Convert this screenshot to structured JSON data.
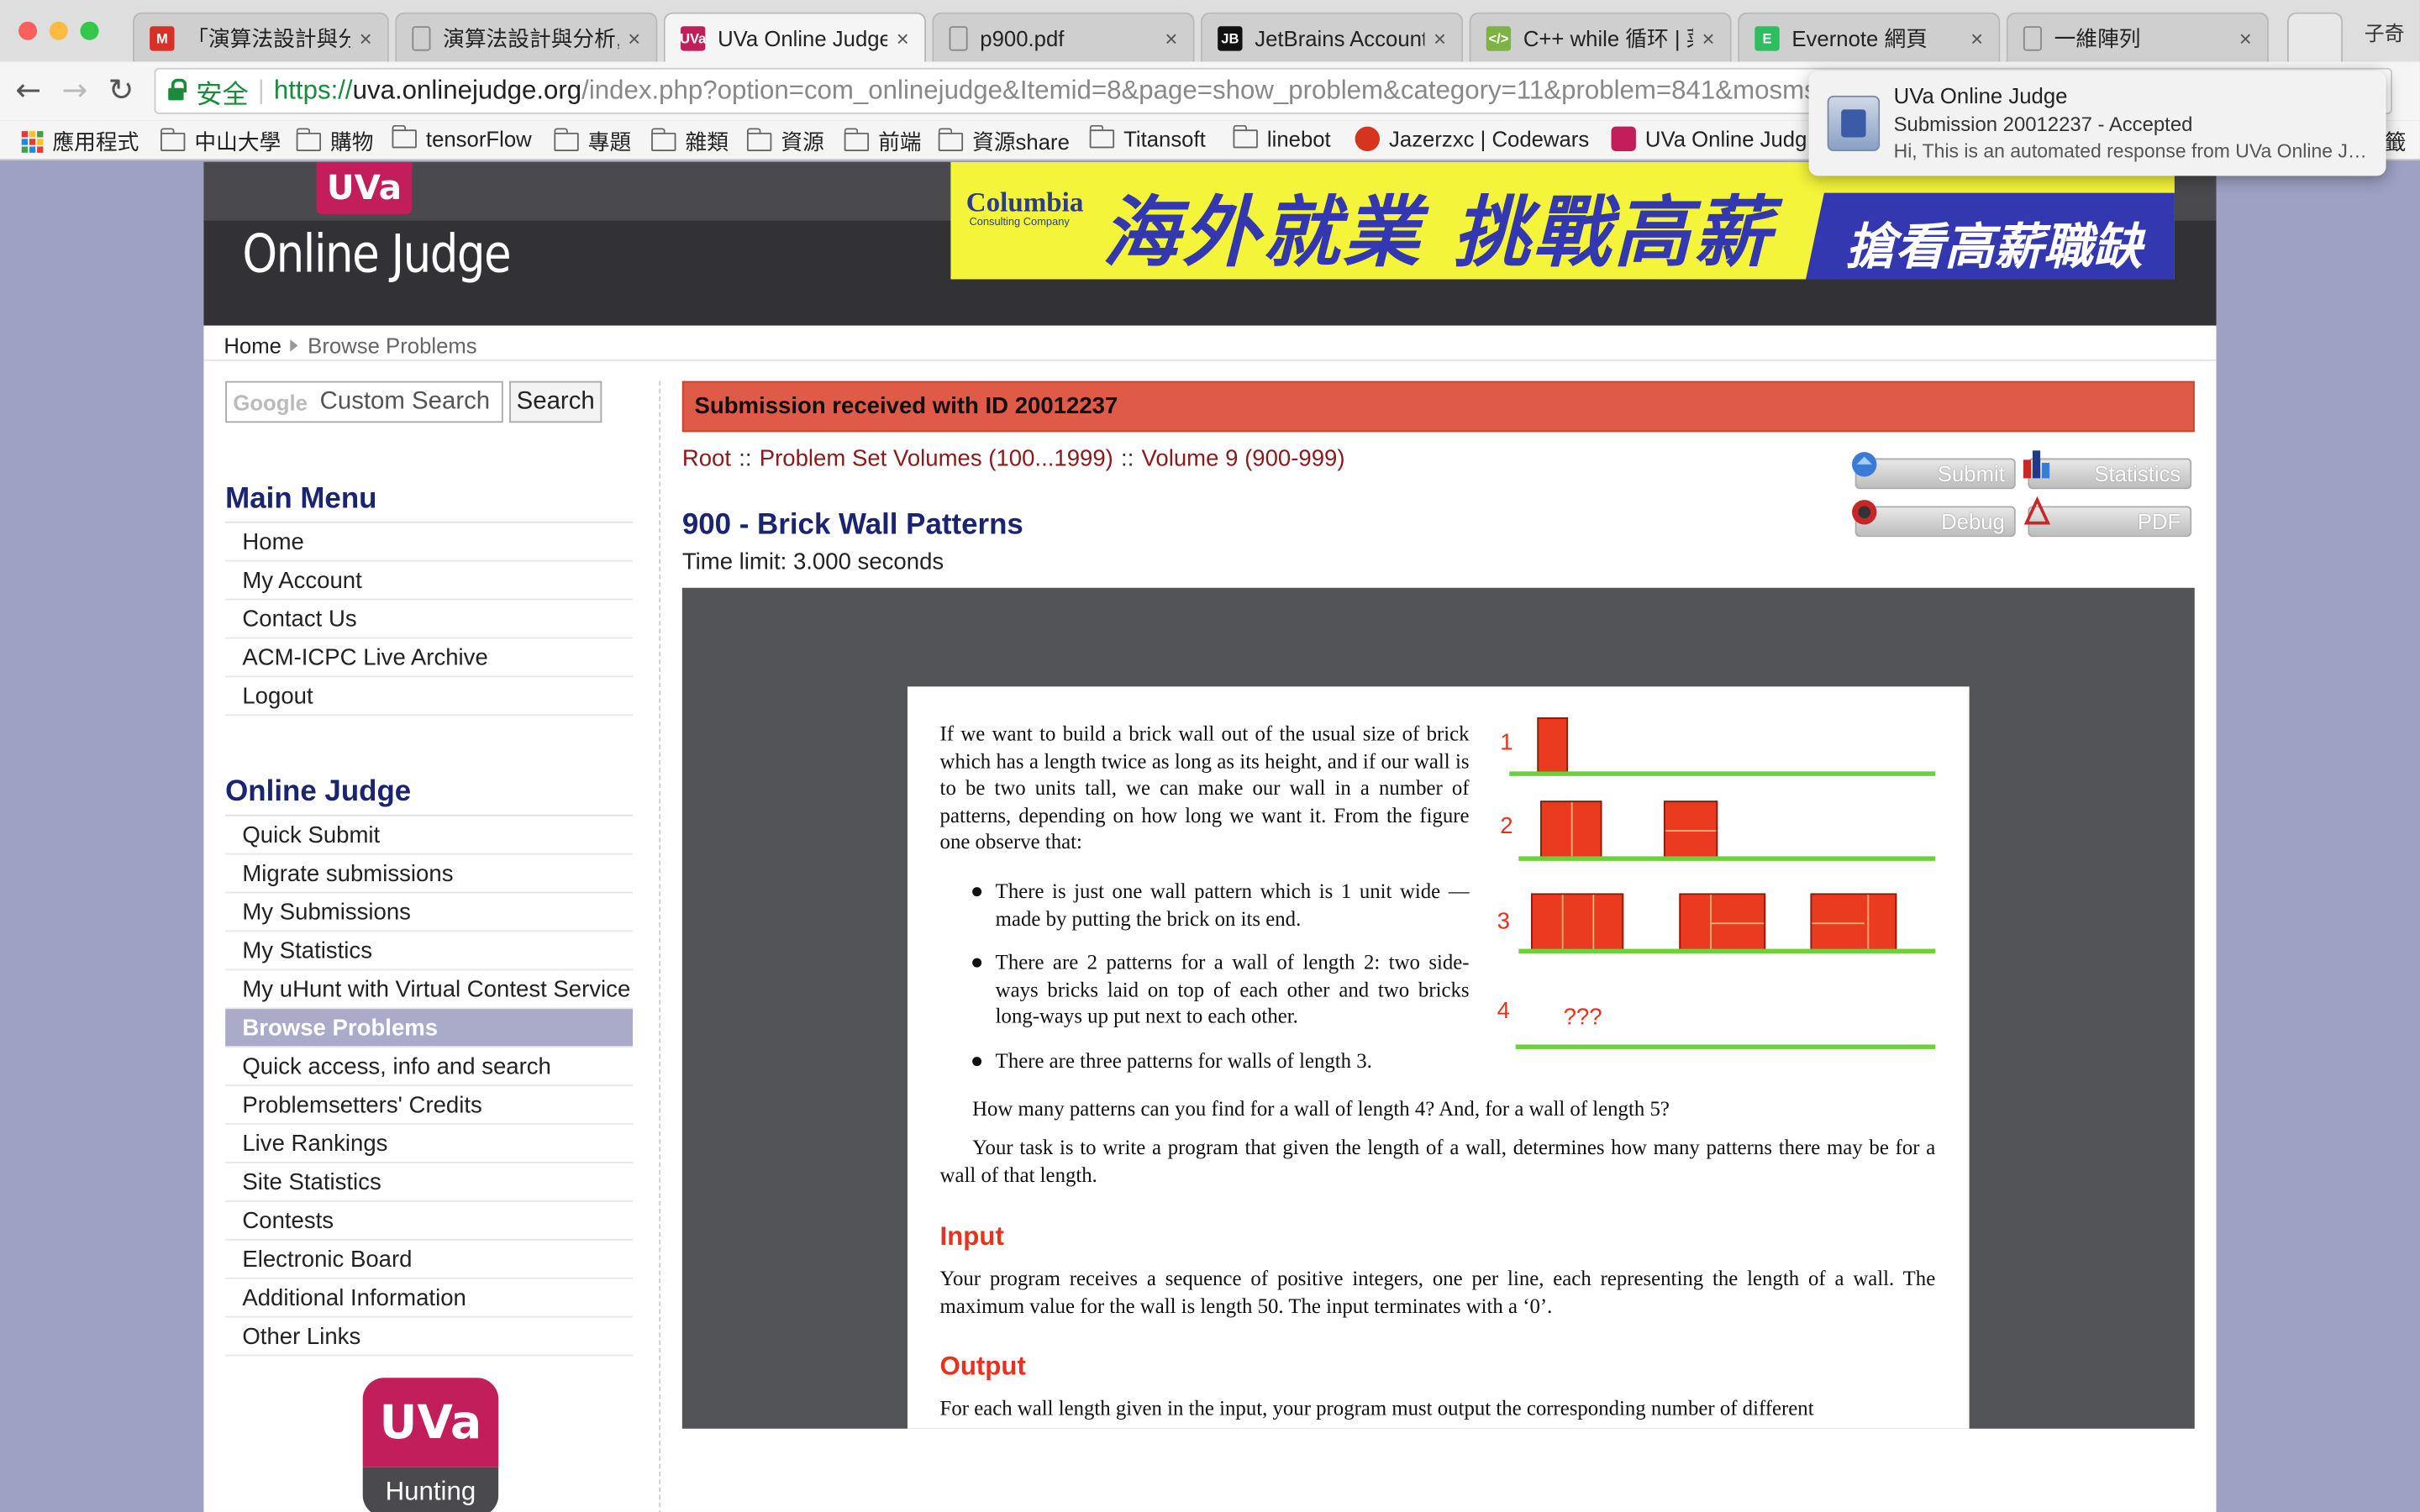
{
  "browser": {
    "tabs": [
      {
        "label": "「演算法設計與分析」",
        "favicon_text": "M",
        "favicon_color": "#d93025"
      },
      {
        "label": "演算法設計與分析,",
        "favicon_text": "",
        "favicon_color": "#888888"
      },
      {
        "label": "UVa Online Judge",
        "favicon_text": "UVa",
        "favicon_color": "#c21e5b"
      },
      {
        "label": "p900.pdf",
        "favicon_text": "",
        "favicon_color": "#888888"
      },
      {
        "label": "JetBrains Account",
        "favicon_text": "JB",
        "favicon_color": "#111111"
      },
      {
        "label": "C++ while 循环 | 菜",
        "favicon_text": "</>",
        "favicon_color": "#7cb342"
      },
      {
        "label": "Evernote 網頁",
        "favicon_text": "E",
        "favicon_color": "#2dbe60"
      },
      {
        "label": "一維陣列",
        "favicon_text": "",
        "favicon_color": "#888888"
      }
    ],
    "profile_name": "子奇",
    "secure_label": "安全",
    "url_scheme": "https://",
    "url_host": "uva.onlinejudge.org",
    "url_rest": "/index.php?option=com_onlinejudge&Itemid=8&page=show_problem&category=11&problem=841&mosmsg=Subm",
    "bookmarks": [
      {
        "label": "應用程式",
        "kind": "apps"
      },
      {
        "label": "中山大學",
        "kind": "folder"
      },
      {
        "label": "購物",
        "kind": "folder"
      },
      {
        "label": "tensorFlow",
        "kind": "folder"
      },
      {
        "label": "專題",
        "kind": "folder"
      },
      {
        "label": "雜類",
        "kind": "folder"
      },
      {
        "label": "資源",
        "kind": "folder"
      },
      {
        "label": "前端",
        "kind": "folder"
      },
      {
        "label": "資源share",
        "kind": "folder"
      },
      {
        "label": "Titansoft",
        "kind": "folder"
      },
      {
        "label": "linebot",
        "kind": "folder"
      },
      {
        "label": "Jazerzxc | Codewars",
        "kind": "codewars"
      },
      {
        "label": "UVa Online Judg",
        "kind": "uva"
      }
    ],
    "bookmark_overflow": "籤"
  },
  "notification": {
    "title": "UVa Online Judge",
    "subtitle": "Submission 20012237 - Accepted",
    "body": "Hi, This is an automated response from UVa Online Judge"
  },
  "site": {
    "logo_top": "UVa",
    "logo_bottom": "Online Judge",
    "ad": {
      "brand": "Columbia",
      "brand_sub": "Consulting Company",
      "headline": "海外就業 挑戰高薪",
      "cta": "搶看高薪職缺"
    },
    "breadcrumb": {
      "home": "Home",
      "current": "Browse Problems"
    },
    "search": {
      "placeholder": "Custom Search",
      "google": "Google",
      "button": "Search"
    }
  },
  "sidebar": {
    "main_menu_title": "Main Menu",
    "main_menu": [
      "Home",
      "My Account",
      "Contact Us",
      "ACM-ICPC Live Archive",
      "Logout"
    ],
    "oj_title": "Online Judge",
    "oj_menu": [
      "Quick Submit",
      "Migrate submissions",
      "My Submissions",
      "My Statistics",
      "My uHunt with Virtual Contest Service",
      "Browse Problems",
      "Quick access, info and search",
      "Problemsetters' Credits",
      "Live Rankings",
      "Site Statistics",
      "Contests",
      "Electronic Board",
      "Additional Information",
      "Other Links"
    ],
    "active_item": "Browse Problems",
    "uhunt_top": "UVa",
    "uhunt_bottom": "Hunting"
  },
  "main": {
    "alert": "Submission received with ID 20012237",
    "path": {
      "root": "Root",
      "sep": "::",
      "volumes": "Problem Set Volumes (100...1999)",
      "volume": "Volume 9 (900-999)"
    },
    "title": "900 - Brick Wall Patterns",
    "time_limit": "Time limit: 3.000 seconds",
    "buttons": {
      "submit": "Submit",
      "statistics": "Statistics",
      "debug": "Debug",
      "pdf": "PDF"
    }
  },
  "problem": {
    "intro": "If we want to build a brick wall out of the usual size of brick which has a length twice as long as its height, and if our wall is to be two units tall, we can make our wall in a number of patterns, depending on how long we want it. From the figure one observe that:",
    "bullets": [
      "There is just one wall pattern which is 1 unit wide — made by putting the brick on its end.",
      "There are 2 patterns for a wall of length 2: two side-ways bricks laid on top of each other and two bricks long-ways up put next to each other.",
      "There are three patterns for walls of length 3."
    ],
    "question": "How many patterns can you find for a wall of length 4? And, for a wall of length 5?",
    "task": "Your task is to write a program that given the length of a wall, determines how many patterns there may be for a wall of that length.",
    "input_title": "Input",
    "input_text": "Your program receives a sequence of positive integers, one per line, each representing the length of a wall. The maximum value for the wall is length 50. The input terminates with a ‘0’.",
    "output_title": "Output",
    "output_text": "For each wall length given in the input, your program must output the corresponding number of different",
    "figure": {
      "labels": [
        "1",
        "2",
        "3",
        "4"
      ],
      "unknown": "???"
    }
  }
}
